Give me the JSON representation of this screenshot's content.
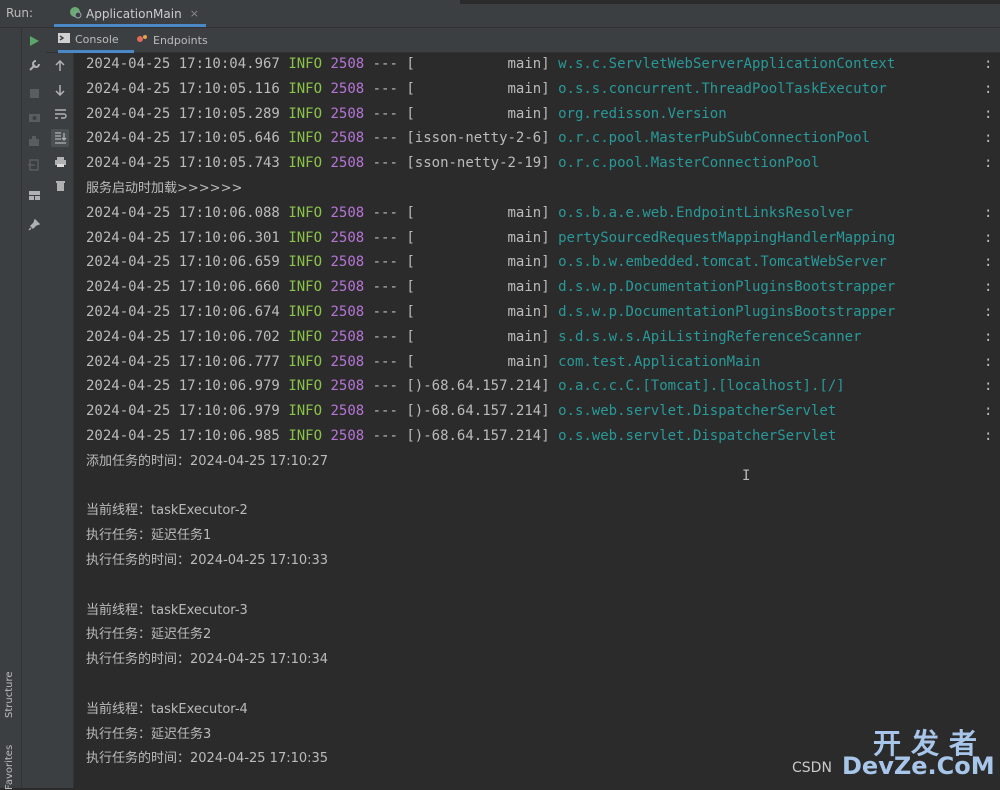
{
  "header": {
    "run_label": "Run:",
    "run_tab_title": "ApplicationMain",
    "close_icon": "close-icon"
  },
  "tabs": [
    {
      "label": "Console",
      "icon": "console-icon"
    },
    {
      "label": "Endpoints",
      "icon": "endpoints-icon"
    }
  ],
  "side_labels": {
    "structure": "Structure",
    "favorites": "Favorites"
  },
  "colors": {
    "info": "#8bc34a",
    "pid": "#b675d6",
    "logger": "#299999",
    "text": "#bbbbbb",
    "accent": "#4a88c7"
  },
  "log_lines": [
    {
      "ts": "2024-04-25 17:10:04.967",
      "level": "INFO",
      "pid": "2508",
      "sep": "---",
      "thread": "[           main]",
      "logger": "w.s.c.ServletWebServerApplicationContext",
      "colon": ":"
    },
    {
      "ts": "2024-04-25 17:10:05.116",
      "level": "INFO",
      "pid": "2508",
      "sep": "---",
      "thread": "[           main]",
      "logger": "o.s.s.concurrent.ThreadPoolTaskExecutor",
      "colon": ":"
    },
    {
      "ts": "2024-04-25 17:10:05.289",
      "level": "INFO",
      "pid": "2508",
      "sep": "---",
      "thread": "[           main]",
      "logger": "org.redisson.Version",
      "colon": ":"
    },
    {
      "ts": "2024-04-25 17:10:05.646",
      "level": "INFO",
      "pid": "2508",
      "sep": "---",
      "thread": "[isson-netty-2-6]",
      "logger": "o.r.c.pool.MasterPubSubConnectionPool",
      "colon": ":"
    },
    {
      "ts": "2024-04-25 17:10:05.743",
      "level": "INFO",
      "pid": "2508",
      "sep": "---",
      "thread": "[sson-netty-2-19]",
      "logger": "o.r.c.pool.MasterConnectionPool",
      "colon": ":"
    },
    {
      "plain": "服务启动时加载>>>>>>"
    },
    {
      "ts": "2024-04-25 17:10:06.088",
      "level": "INFO",
      "pid": "2508",
      "sep": "---",
      "thread": "[           main]",
      "logger": "o.s.b.a.e.web.EndpointLinksResolver",
      "colon": ":"
    },
    {
      "ts": "2024-04-25 17:10:06.301",
      "level": "INFO",
      "pid": "2508",
      "sep": "---",
      "thread": "[           main]",
      "logger": "pertySourcedRequestMappingHandlerMapping",
      "colon": ":"
    },
    {
      "ts": "2024-04-25 17:10:06.659",
      "level": "INFO",
      "pid": "2508",
      "sep": "---",
      "thread": "[           main]",
      "logger": "o.s.b.w.embedded.tomcat.TomcatWebServer",
      "colon": ":"
    },
    {
      "ts": "2024-04-25 17:10:06.660",
      "level": "INFO",
      "pid": "2508",
      "sep": "---",
      "thread": "[           main]",
      "logger": "d.s.w.p.DocumentationPluginsBootstrapper",
      "colon": ":"
    },
    {
      "ts": "2024-04-25 17:10:06.674",
      "level": "INFO",
      "pid": "2508",
      "sep": "---",
      "thread": "[           main]",
      "logger": "d.s.w.p.DocumentationPluginsBootstrapper",
      "colon": ":"
    },
    {
      "ts": "2024-04-25 17:10:06.702",
      "level": "INFO",
      "pid": "2508",
      "sep": "---",
      "thread": "[           main]",
      "logger": "s.d.s.w.s.ApiListingReferenceScanner",
      "colon": ":"
    },
    {
      "ts": "2024-04-25 17:10:06.777",
      "level": "INFO",
      "pid": "2508",
      "sep": "---",
      "thread": "[           main]",
      "logger": "com.test.ApplicationMain",
      "colon": ":"
    },
    {
      "ts": "2024-04-25 17:10:06.979",
      "level": "INFO",
      "pid": "2508",
      "sep": "---",
      "thread": "[)-68.64.157.214]",
      "logger": "o.a.c.c.C.[Tomcat].[localhost].[/]",
      "colon": ":"
    },
    {
      "ts": "2024-04-25 17:10:06.979",
      "level": "INFO",
      "pid": "2508",
      "sep": "---",
      "thread": "[)-68.64.157.214]",
      "logger": "o.s.web.servlet.DispatcherServlet",
      "colon": ":"
    },
    {
      "ts": "2024-04-25 17:10:06.985",
      "level": "INFO",
      "pid": "2508",
      "sep": "---",
      "thread": "[)-68.64.157.214]",
      "logger": "o.s.web.servlet.DispatcherServlet",
      "colon": ":"
    },
    {
      "plain": "添加任务的时间：2024-04-25 17:10:27"
    },
    {
      "plain": ""
    },
    {
      "plain": "当前线程：taskExecutor-2"
    },
    {
      "plain": "执行任务：延迟任务1"
    },
    {
      "plain": "执行任务的时间：2024-04-25 17:10:33"
    },
    {
      "plain": ""
    },
    {
      "plain": "当前线程：taskExecutor-3"
    },
    {
      "plain": "执行任务：延迟任务2"
    },
    {
      "plain": "执行任务的时间：2024-04-25 17:10:34"
    },
    {
      "plain": ""
    },
    {
      "plain": "当前线程：taskExecutor-4"
    },
    {
      "plain": "执行任务：延迟任务3"
    },
    {
      "plain": "执行任务的时间：2024-04-25 17:10:35"
    }
  ],
  "watermark": {
    "top": "开发者",
    "csdn": "CSDN",
    "brand": "DevZe.CoM"
  }
}
